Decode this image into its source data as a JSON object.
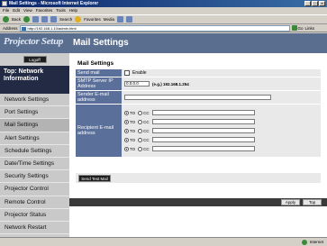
{
  "window": {
    "title": "Mail Settings - Microsoft Internet Explorer"
  },
  "menu": [
    "File",
    "Edit",
    "View",
    "Favorites",
    "Tools",
    "Help"
  ],
  "toolbar": {
    "back": "Back",
    "search": "Search",
    "favorites": "Favorites",
    "media": "Media"
  },
  "address": {
    "label": "Address",
    "url": "http://192.168.1.10/admin.html",
    "go": "Go",
    "links": "Links"
  },
  "sidebar": {
    "logo": "Projector Setup",
    "logoff": "Logoff",
    "top": "Top: Network Information",
    "items": [
      "Network Settings",
      "Port Settings",
      "Mail Settings",
      "Alert Settings",
      "Schedule Settings",
      "Date/Time Settings",
      "Security Settings",
      "Projector Control",
      "Remote Control",
      "Projector Status",
      "Network Restart"
    ]
  },
  "main": {
    "title": "Mail Settings",
    "section": "Mail Settings",
    "send_mail": {
      "label": "Send mail",
      "option": "Enable"
    },
    "smtp": {
      "label": "SMTP Server IP Address",
      "value": "0.0.0.0",
      "hint": "(e.g.) 192.168.1.254"
    },
    "sender": {
      "label": "Sender E-mail address",
      "value": ""
    },
    "recipient": {
      "label": "Recipient E-mail address",
      "to": "TO",
      "cc": "CC",
      "count": 5
    },
    "send_test": "Send Test Mail",
    "apply": "Apply",
    "top": "Top"
  },
  "status": {
    "zone": "Internet"
  }
}
